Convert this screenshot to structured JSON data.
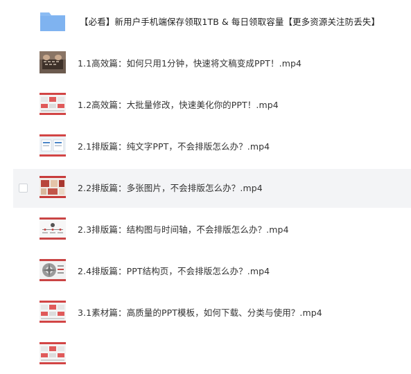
{
  "files": [
    {
      "name": "【必看】新用户手机端保存领取1TB & 每日领取容量【更多资源关注防丢失】",
      "icon": "folder-icon",
      "kind": "folder"
    },
    {
      "name": "1.1高效篇：如何只用1分钟，快速将文稿变成PPT！.mp4",
      "icon": "video-thumbnail-icon",
      "kind": "video",
      "thumb": "dark"
    },
    {
      "name": "1.2高效篇：大批量修改，快速美化你的PPT！.mp4",
      "icon": "video-thumbnail-icon",
      "kind": "video",
      "thumb": "slides-red"
    },
    {
      "name": "2.1排版篇：纯文字PPT，不会排版怎么办？.mp4",
      "icon": "video-thumbnail-icon",
      "kind": "video",
      "thumb": "slides-blue"
    },
    {
      "name": "2.2排版篇：多张图片，不会排版怎么办？.mp4",
      "icon": "video-thumbnail-icon",
      "kind": "video",
      "thumb": "photos",
      "hovered": true
    },
    {
      "name": "2.3排版篇：结构图与时间轴，不会排版怎么办？.mp4",
      "icon": "video-thumbnail-icon",
      "kind": "video",
      "thumb": "slides-gray"
    },
    {
      "name": "2.4排版篇：PPT结构页，不会排版怎么办？.mp4",
      "icon": "video-thumbnail-icon",
      "kind": "video",
      "thumb": "wheel"
    },
    {
      "name": "3.1素材篇：高质量的PPT模板，如何下载、分类与使用？.mp4",
      "icon": "video-thumbnail-icon",
      "kind": "video",
      "thumb": "slides-red"
    },
    {
      "name": "",
      "icon": "video-thumbnail-icon",
      "kind": "video",
      "thumb": "slides-red"
    }
  ],
  "colors": {
    "folder": "#7fb3f0",
    "hover_bg": "#f3f4f6",
    "text": "#333333"
  }
}
